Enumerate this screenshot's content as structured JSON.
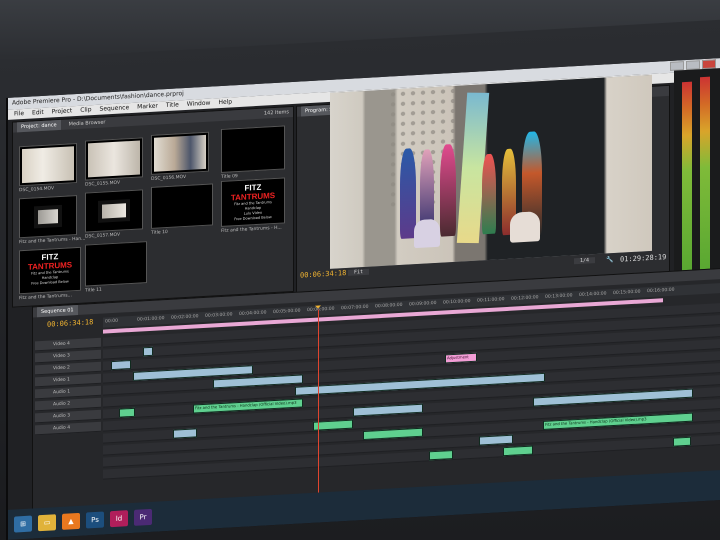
{
  "window": {
    "title": "Adobe Premiere Pro - D:\\Documents\\fashion\\dance.prproj",
    "menus": [
      "File",
      "Edit",
      "Project",
      "Clip",
      "Sequence",
      "Marker",
      "Title",
      "Window",
      "Help"
    ]
  },
  "project": {
    "tabs": [
      "Project: dance",
      "Media Browser"
    ],
    "items_count": "142 Items",
    "thumbs": [
      {
        "name": "DSC_0154.MOV",
        "dur": "10:29"
      },
      {
        "name": "DSC_0155.MOV",
        "dur": "26:28"
      },
      {
        "name": "DSC_0156.MOV",
        "dur": "26:22"
      },
      {
        "name": "Title 09",
        "dur": "4:00"
      },
      {
        "name": "Fitz and the Tantrums - Han...",
        "dur": "3:26:04"
      },
      {
        "name": "DSC_0157.MOV",
        "dur": "1:18:82"
      },
      {
        "name": "Title 10",
        "dur": "4:00"
      },
      {
        "name": "Fitz and the Tantrums - H...",
        "dur": "3:22:11"
      },
      {
        "name": "Fitz and the Tantrums...",
        "dur": "3:22:11"
      },
      {
        "name": "Title 11",
        "dur": "4:00"
      }
    ],
    "fitz_logo_left": "FITZ",
    "fitz_logo_right": "TANTRUMS",
    "fitz_lines": [
      "Fitz and the Tantrums",
      "Handclap",
      "Lulu Video",
      "Free Download Below"
    ]
  },
  "program": {
    "tab": "Program: Sequence 01",
    "timecode": "00:06:34:18",
    "fit": "Fit",
    "fraction": "1/4",
    "duration": "01:29:28:19"
  },
  "timeline": {
    "tab": "Sequence 01",
    "timecode": "00:06:34:18",
    "ruler": [
      "00:00",
      "00:01:00:00",
      "00:02:00:00",
      "00:03:00:00",
      "00:04:00:00",
      "00:05:00:00",
      "00:06:00:00",
      "00:07:00:00",
      "00:08:00:00",
      "00:09:00:00",
      "00:10:00:00",
      "00:11:00:00",
      "00:12:00:00",
      "00:13:00:00",
      "00:14:00:00",
      "00:15:00:00",
      "00:16:00:00"
    ],
    "tracks": [
      "Video 4",
      "Video 3",
      "Video 2",
      "Video 1",
      "Audio 1",
      "Audio 2",
      "Audio 3",
      "Audio 4"
    ],
    "adjustment_label": "Adjustment",
    "audio_clip_label": "Fitz and the Tantrums - Handclap (Official Video).mp3"
  },
  "taskbar": [
    "Start",
    "Explorer",
    "VLC",
    "Photoshop",
    "InDesign",
    "Premiere"
  ]
}
